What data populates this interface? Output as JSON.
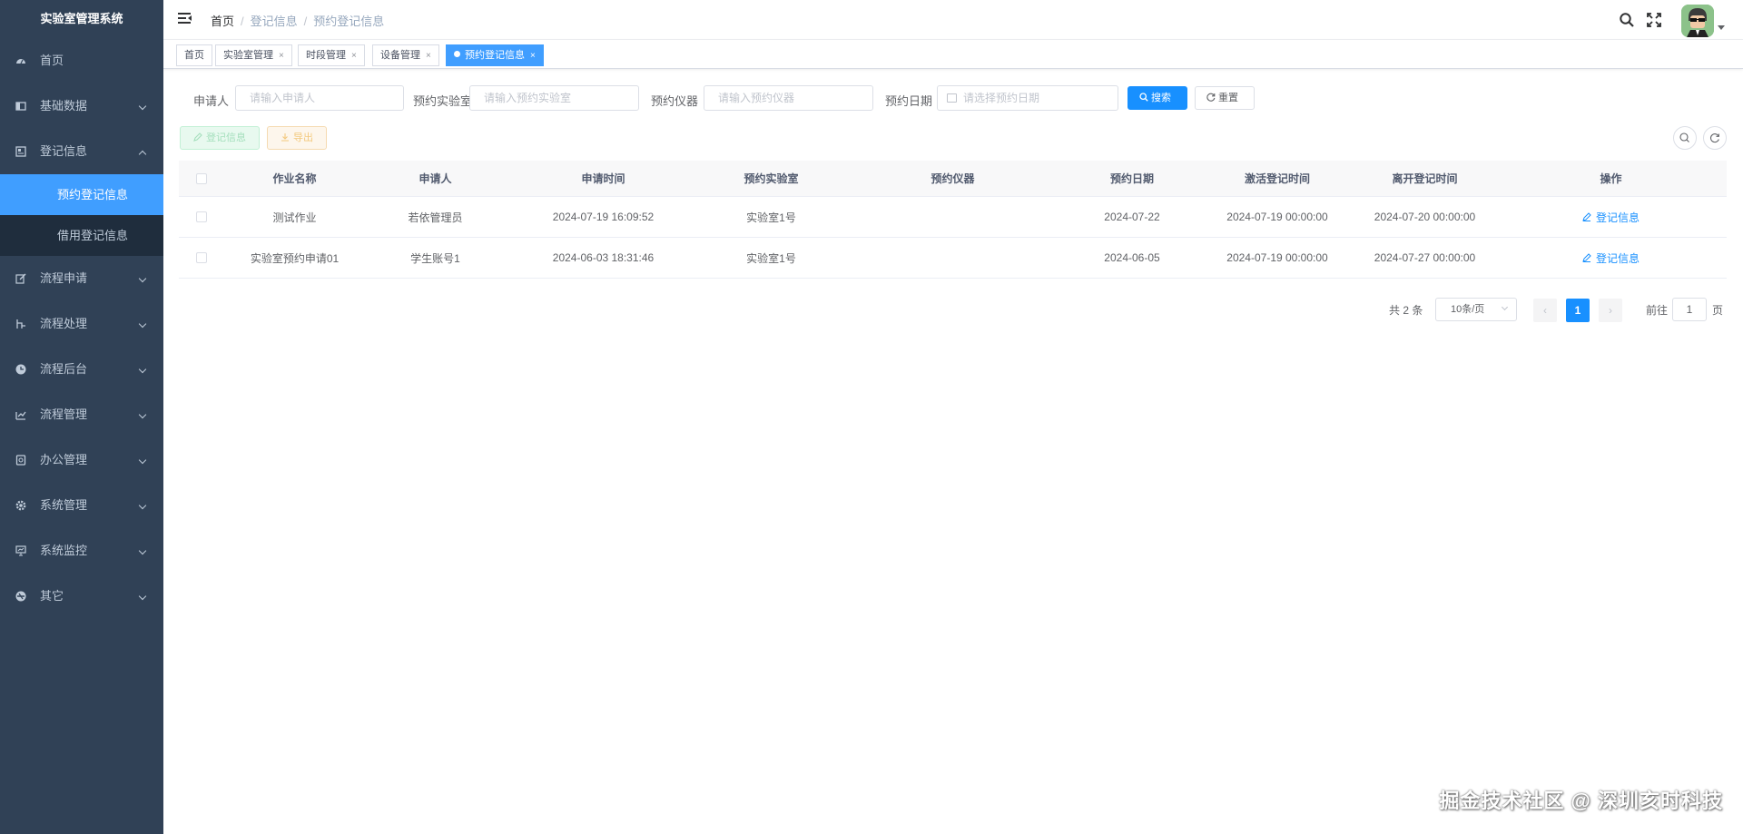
{
  "app": {
    "title": "实验室管理系统"
  },
  "sidebar": {
    "items": [
      {
        "label": "首页",
        "icon": "dashboard-icon"
      },
      {
        "label": "基础数据",
        "icon": "table-icon"
      },
      {
        "label": "登记信息",
        "icon": "form-icon",
        "expanded": true,
        "children": [
          {
            "label": "预约登记信息",
            "active": true
          },
          {
            "label": "借用登记信息"
          }
        ]
      },
      {
        "label": "流程申请",
        "icon": "edit-icon"
      },
      {
        "label": "流程处理",
        "icon": "process-icon"
      },
      {
        "label": "流程后台",
        "icon": "clock-icon"
      },
      {
        "label": "流程管理",
        "icon": "chart-icon"
      },
      {
        "label": "办公管理",
        "icon": "phone-icon"
      },
      {
        "label": "系统管理",
        "icon": "gear-icon"
      },
      {
        "label": "系统监控",
        "icon": "monitor-icon"
      },
      {
        "label": "其它",
        "icon": "guide-icon"
      }
    ]
  },
  "header": {
    "breadcrumb": [
      "首页",
      "登记信息",
      "预约登记信息"
    ]
  },
  "tags": [
    {
      "label": "首页"
    },
    {
      "label": "实验室管理",
      "close": "×"
    },
    {
      "label": "时段管理",
      "close": "×"
    },
    {
      "label": "设备管理",
      "close": "×"
    },
    {
      "label": "预约登记信息",
      "close": "×",
      "active": true
    }
  ],
  "search": {
    "applicant_label": "申请人",
    "applicant_placeholder": "请输入申请人",
    "lab_label": "预约实验室",
    "lab_placeholder": "请输入预约实验室",
    "instrument_label": "预约仪器",
    "instrument_placeholder": "请输入预约仪器",
    "date_label": "预约日期",
    "date_placeholder": "请选择预约日期",
    "search_btn": "搜索",
    "reset_btn": "重置"
  },
  "toolbar": {
    "register_btn": "登记信息",
    "export_btn": "导出"
  },
  "table": {
    "columns": [
      "作业名称",
      "申请人",
      "申请时间",
      "预约实验室",
      "预约仪器",
      "预约日期",
      "激活登记时间",
      "离开登记时间",
      "操作"
    ],
    "rows": [
      {
        "name": "测试作业",
        "applicant": "若依管理员",
        "apply_time": "2024-07-19 16:09:52",
        "lab": "实验室1号",
        "instrument": "",
        "date": "2024-07-22",
        "activate_time": "2024-07-19 00:00:00",
        "leave_time": "2024-07-20 00:00:00",
        "action": "登记信息"
      },
      {
        "name": "实验室预约申请01",
        "applicant": "学生账号1",
        "apply_time": "2024-06-03 18:31:46",
        "lab": "实验室1号",
        "instrument": "",
        "date": "2024-06-05",
        "activate_time": "2024-07-19 00:00:00",
        "leave_time": "2024-07-27 00:00:00",
        "action": "登记信息"
      }
    ]
  },
  "pagination": {
    "total_text": "共 2 条",
    "page_size": "10条/页",
    "current_page": "1",
    "prev": "‹",
    "next": "›",
    "goto_label": "前往",
    "goto_value": "1",
    "page_unit": "页"
  },
  "watermark": "掘金技术社区 @ 深圳亥时科技",
  "colors": {
    "sidebar_bg": "#304156",
    "primary": "#1890ff",
    "active_menu": "#409eff"
  }
}
